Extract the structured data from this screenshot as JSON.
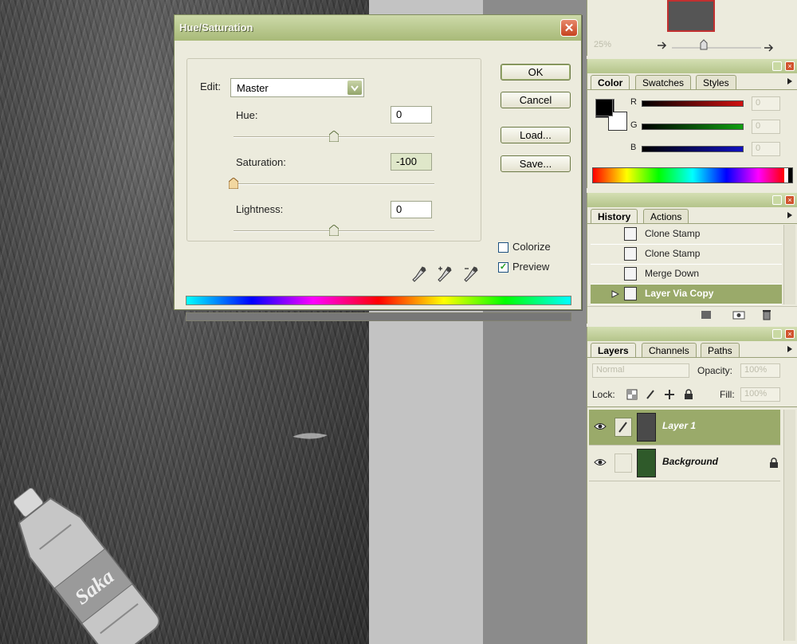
{
  "dialog": {
    "title": "Hue/Saturation",
    "close_glyph": "✕",
    "edit_label": "Edit:",
    "edit_value": "Master",
    "hue_label": "Hue:",
    "hue_value": "0",
    "saturation_label": "Saturation:",
    "saturation_value": "-100",
    "lightness_label": "Lightness:",
    "lightness_value": "0",
    "hue_level": 0.5,
    "saturation_level": 0.0,
    "lightness_level": 0.5,
    "buttons": {
      "ok": "OK",
      "cancel": "Cancel",
      "load": "Load...",
      "save": "Save..."
    },
    "colorize_label": "Colorize",
    "colorize_checked": false,
    "preview_label": "Preview",
    "preview_checked": true
  },
  "navigator": {
    "zoom": "25%"
  },
  "color_panel": {
    "tabs": [
      "Color",
      "Swatches",
      "Styles"
    ],
    "channels": [
      {
        "label": "R",
        "value": "0",
        "color": "#d01010"
      },
      {
        "label": "G",
        "value": "0",
        "color": "#10a010"
      },
      {
        "label": "B",
        "value": "0",
        "color": "#1010c0"
      }
    ],
    "foreground": "#000000",
    "background": "#ffffff"
  },
  "history_panel": {
    "tabs": [
      "History",
      "Actions"
    ],
    "items": [
      "Clone Stamp",
      "Clone Stamp",
      "Merge Down",
      "Layer Via Copy"
    ],
    "selected_index": 3
  },
  "layers_panel": {
    "tabs": [
      "Layers",
      "Channels",
      "Paths"
    ],
    "blend_mode": "Normal",
    "opacity_label": "Opacity:",
    "opacity_value": "100%",
    "lock_label": "Lock:",
    "fill_label": "Fill:",
    "fill_value": "100%",
    "layers": [
      {
        "name": "Layer 1",
        "selected": true
      },
      {
        "name": "Background",
        "selected": false
      }
    ]
  },
  "canvas": {
    "bottle_label": "Saka"
  },
  "colors": {
    "accent": "#a8ba78",
    "panel_bg": "#ecebdd",
    "selected_row": "#9aaa6a",
    "close_red": "#c6431f"
  }
}
